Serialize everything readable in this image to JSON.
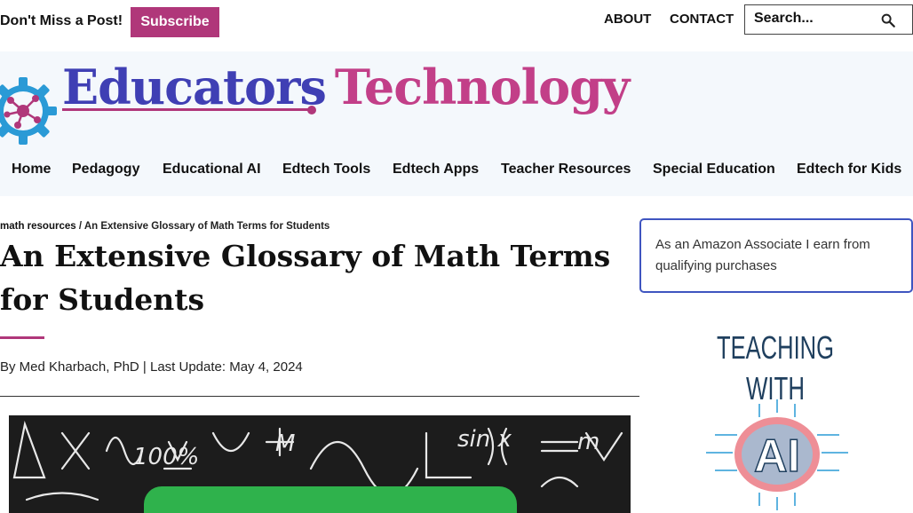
{
  "topbar": {
    "promo": "Don't Miss a Post!",
    "subscribe": "Subscribe",
    "links": [
      "ABOUT",
      "CONTACT"
    ],
    "search_placeholder": "Search..."
  },
  "brand": {
    "word1": "Educators",
    "word2": "Technology"
  },
  "nav": [
    "Home",
    "Pedagogy",
    "Educational AI",
    "Edtech Tools",
    "Edtech Apps",
    "Teacher Resources",
    "Special Education",
    "Edtech for Kids"
  ],
  "breadcrumb": {
    "parent": "math resources",
    "sep": " / ",
    "current": "An Extensive Glossary of Math Terms for Students"
  },
  "article": {
    "title": "An Extensive Glossary of Math Terms for Students",
    "byline": "By Med Kharbach, PhD | Last Update: May 4, 2024"
  },
  "sidebar": {
    "disclosure": "As an Amazon Associate I earn from qualifying purchases",
    "book_line1": "TEACHING",
    "book_line2": "WITH",
    "book_line3": "AI"
  },
  "colors": {
    "accent": "#b0377a",
    "brand_blue": "#3f3fb4",
    "brand_pink": "#c23f88",
    "header_bg": "#f4f8fc",
    "disclosure_border": "#3f55c0"
  },
  "icons": [
    "search-icon",
    "gear-logo-icon"
  ]
}
